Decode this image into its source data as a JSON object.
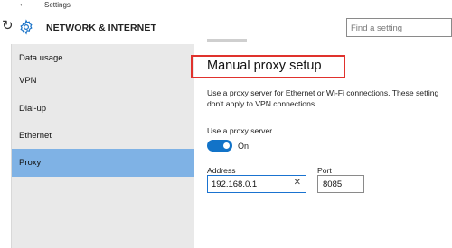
{
  "window": {
    "title": "Settings",
    "back_icon": "back-arrow-icon"
  },
  "header": {
    "title": "NETWORK & INTERNET",
    "icon": "gear-icon",
    "refresh_icon": "refresh-icon",
    "search_placeholder": "Find a setting"
  },
  "sidebar": {
    "items": [
      {
        "label": "Data usage",
        "active": false
      },
      {
        "label": "VPN",
        "active": false
      },
      {
        "label": "Dial-up",
        "active": false
      },
      {
        "label": "Ethernet",
        "active": false
      },
      {
        "label": "Proxy",
        "active": true
      }
    ],
    "active_color": "#7fb2e5"
  },
  "main": {
    "heading": "Manual proxy setup",
    "description_line1": "Use a proxy server for Ethernet or Wi-Fi connections. These setting",
    "description_line2": "don't apply to VPN connections.",
    "toggle": {
      "label": "Use a proxy server",
      "state": "On",
      "on": true,
      "color": "#1273c8"
    },
    "address": {
      "label": "Address",
      "value": "192.168.0.1"
    },
    "port": {
      "label": "Port",
      "value": "8085"
    },
    "highlight_color": "#e0322d"
  }
}
